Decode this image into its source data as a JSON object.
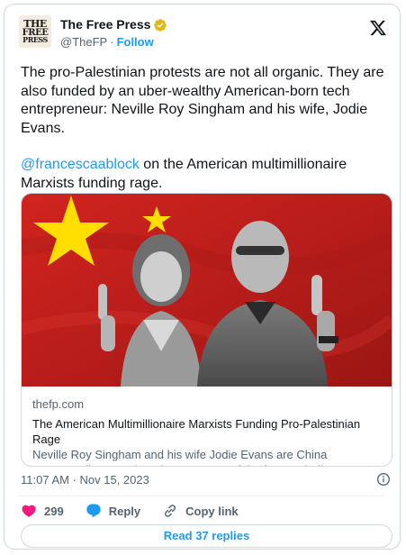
{
  "header": {
    "avatar_text": [
      "THE",
      "FREE",
      "PRESS"
    ],
    "author_name": "The Free Press",
    "handle": "@TheFP",
    "separator": "·",
    "follow_label": "Follow",
    "verified_color": "#e2b719",
    "logo_icon": "x-logo-icon"
  },
  "tweet": {
    "paragraph1": "The pro-Palestinian protests are not all organic. They are also funded by an uber-wealthy American-born tech entrepreneur: Neville Roy Singham and his wife, Jodie Evans.",
    "mention": "@francescaablock",
    "paragraph2_rest": " on the American multimillionaire Marxists funding rage."
  },
  "link_card": {
    "image_icon": "photo-couple-in-front-of-chinese-flag",
    "domain": "thefp.com",
    "title": "The American Multimillionaire Marxists Funding Pro-Palestinian Rage",
    "description": "Neville Roy Singham and his wife Jodie Evans are China propagandists—and a primary source of the fury exploding on our streets."
  },
  "meta": {
    "timestamp": "11:07 AM · Nov 15, 2023",
    "info_icon": "info-icon"
  },
  "actions": {
    "likes": "299",
    "reply_label": "Reply",
    "copy_label": "Copy link"
  },
  "read_replies_label": "Read 37 replies",
  "colors": {
    "accent": "#1d9bf0",
    "like": "#f91880",
    "flag_red": "#c8231f",
    "flag_star": "#ffde00"
  }
}
